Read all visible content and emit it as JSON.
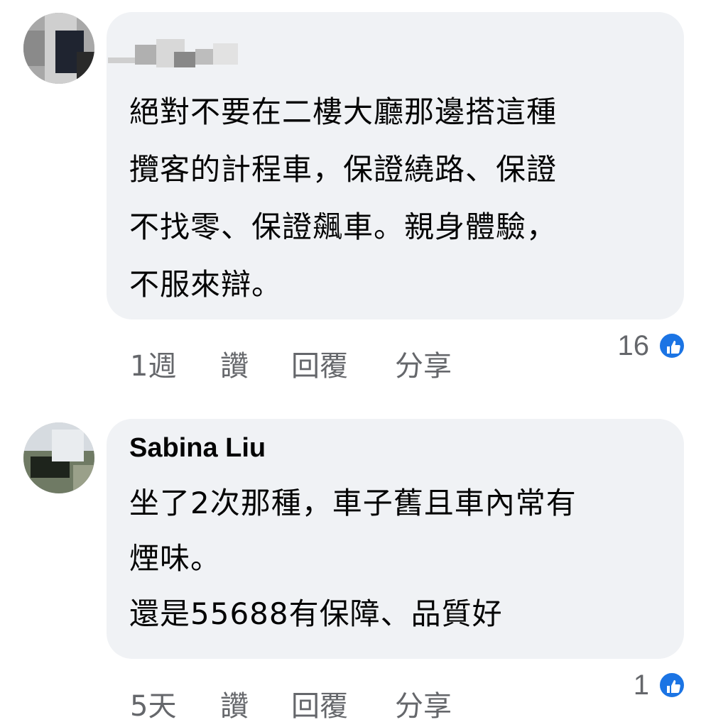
{
  "comments": [
    {
      "author": "",
      "text": "絕對不要在二樓大廳那邊搭這種\n攬客的計程車，保證繞路、保證\n不找零、保證飆車。親身體驗，\n不服來辯。",
      "time": "1週",
      "like_label": "讚",
      "reply_label": "回覆",
      "share_label": "分享",
      "like_count": "16"
    },
    {
      "author": "Sabina Liu",
      "text": "坐了2次那種，車子舊且車內常有\n煙味。\n還是55688有保障、品質好",
      "time": "5天",
      "like_label": "讚",
      "reply_label": "回覆",
      "share_label": "分享",
      "like_count": "1"
    }
  ],
  "colors": {
    "bubble": "#f0f2f5",
    "like_blue": "#1b74e4",
    "meta_gray": "#65676b"
  },
  "icons": [
    "like-thumb-icon"
  ]
}
